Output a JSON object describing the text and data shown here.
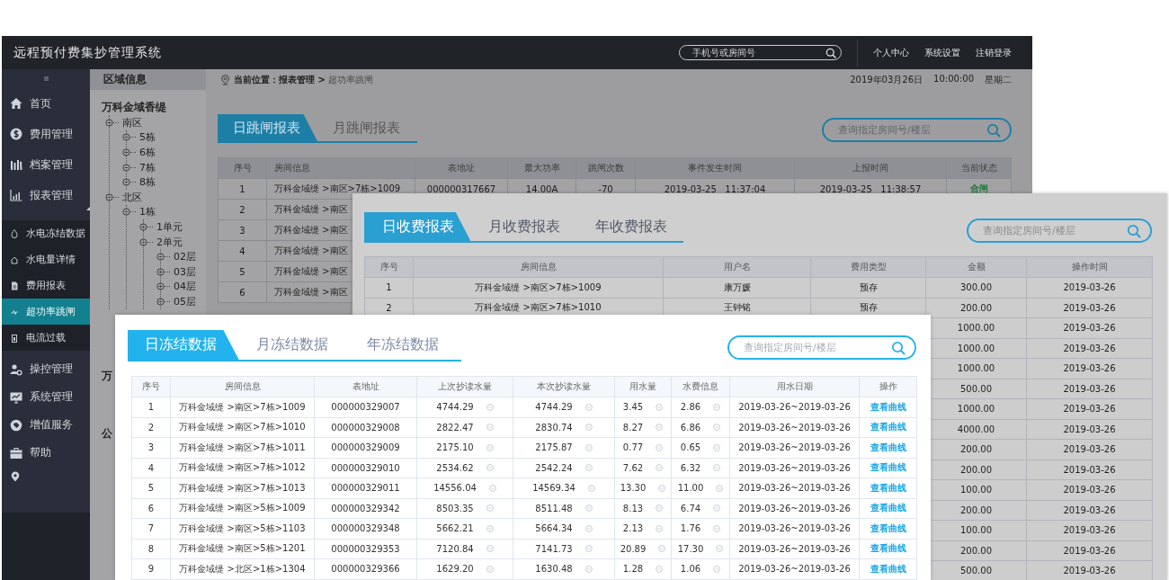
{
  "header": {
    "title": "远程预付费集抄管理系统",
    "search": {
      "placeholder": "手机号或房间号"
    },
    "links": [
      "个人中心",
      "系统设置",
      "注销登录"
    ]
  },
  "sidebar": {
    "items": [
      {
        "label": "首页",
        "selected": false,
        "expanded": false
      },
      {
        "label": "费用管理",
        "selected": false,
        "expanded": false
      },
      {
        "label": "档案管理",
        "selected": false,
        "expanded": false
      },
      {
        "label": "报表管理",
        "selected": false,
        "expanded": true,
        "children": [
          {
            "label": "水电冻结数据",
            "selected": false
          },
          {
            "label": "水电量详情",
            "selected": false
          },
          {
            "label": "费用报表",
            "selected": false
          },
          {
            "label": "超功率跳闸",
            "selected": true
          },
          {
            "label": "电流过载",
            "selected": false
          }
        ]
      },
      {
        "label": "操控管理",
        "selected": false,
        "expanded": false
      },
      {
        "label": "系统管理",
        "selected": false,
        "expanded": false
      },
      {
        "label": "增值服务",
        "selected": false,
        "expanded": false
      },
      {
        "label": "帮助",
        "selected": false,
        "expanded": false
      }
    ]
  },
  "region_panel": {
    "title": "区域信息",
    "nodes": [
      {
        "label": "万科金域香缇",
        "children": [
          {
            "label": "南区",
            "children": [
              {
                "label": "5栋"
              },
              {
                "label": "6栋"
              },
              {
                "label": "7栋"
              },
              {
                "label": "8栋"
              }
            ]
          },
          {
            "label": "北区",
            "children": [
              {
                "label": "1栋",
                "children": [
                  {
                    "label": "1单元"
                  },
                  {
                    "label": "2单元",
                    "children": [
                      {
                        "label": "02层"
                      },
                      {
                        "label": "03层"
                      },
                      {
                        "label": "04层"
                      },
                      {
                        "label": "05层"
                      }
                    ]
                  }
                ]
              }
            ]
          }
        ]
      },
      {
        "label": "万"
      },
      {
        "label": "公"
      }
    ]
  },
  "breadcrumb": "**当前位置：报表管理 >** 超功率跳闸",
  "datetime": {
    "date": "2019年03月26日",
    "time": "10:00:00",
    "weekday": "星期二"
  },
  "trip_report": {
    "tabs": [
      {
        "label": "日跳闸报表",
        "selected": true
      },
      {
        "label": "月跳闸报表",
        "selected": false
      }
    ],
    "search": {
      "placeholder": "查询指定房间号/楼层"
    },
    "table": {
      "columns": [
        {
          "label": "序号",
          "kind": "text"
        },
        {
          "label": "房间信息",
          "kind": "text"
        },
        {
          "label": "表地址",
          "kind": "text"
        },
        {
          "label": "最大功率",
          "kind": "text"
        },
        {
          "label": "跳闸次数",
          "kind": "text"
        },
        {
          "label": "事件发生时间",
          "kind": "text"
        },
        {
          "label": "上报时间",
          "kind": "text"
        },
        {
          "label": "当前状态",
          "kind": "status"
        }
      ],
      "rows": [
        {
          "seq": "1",
          "room": "万科金域缇 >南区>7栋>1009",
          "meter": "000000317667",
          "max_power": "14.00A",
          "trips": "-70",
          "event_time": "2019-03-25   11:37:04",
          "report_time": "2019-03-25   11:38:57",
          "status": "合闸"
        },
        {
          "seq": "2",
          "room": "万科金域缇 >南区"
        },
        {
          "seq": "3",
          "room": "万科金域缇 >南区"
        },
        {
          "seq": "4",
          "room": "万科金域缇 >南区"
        },
        {
          "seq": "5",
          "room": "万科金域缇 >南区"
        },
        {
          "seq": "6",
          "room": "万科金域缇 >南区"
        }
      ]
    }
  },
  "fee_report": {
    "tabs": [
      {
        "label": "日收费报表",
        "selected": true
      },
      {
        "label": "月收费报表",
        "selected": false
      },
      {
        "label": "年收费报表",
        "selected": false
      }
    ],
    "search": {
      "placeholder": "查询指定房间号/楼层"
    },
    "table": {
      "columns": [
        {
          "label": "序号",
          "kind": "text"
        },
        {
          "label": "房间信息",
          "kind": "text"
        },
        {
          "label": "用户名",
          "kind": "text"
        },
        {
          "label": "费用类型",
          "kind": "text"
        },
        {
          "label": "金额",
          "kind": "text"
        },
        {
          "label": "操作时间",
          "kind": "text"
        }
      ],
      "rows": [
        {
          "seq": "1",
          "room": "万科金域缇 >南区>7栋>1009",
          "user": "康万媛",
          "fee_type": "预存",
          "amount": "300.00",
          "time": "2019-03-26"
        },
        {
          "seq": "2",
          "room": "万科金域缇 >南区>7栋>1010",
          "user": "王钟铭",
          "fee_type": "预存",
          "amount": "200.00",
          "time": "2019-03-26"
        },
        {
          "amount": "1000.00",
          "time": "2019-03-26"
        },
        {
          "amount": "1000.00",
          "time": "2019-03-26"
        },
        {
          "amount": "1000.00",
          "time": "2019-03-26"
        },
        {
          "amount": "500.00",
          "time": "2019-03-26"
        },
        {
          "amount": "1000.00",
          "time": "2019-03-26"
        },
        {
          "amount": "4000.00",
          "time": "2019-03-26"
        },
        {
          "amount": "200.00",
          "time": "2019-03-26"
        },
        {
          "amount": "200.00",
          "time": "2019-03-26"
        },
        {
          "amount": "100.00",
          "time": "2019-03-26"
        },
        {
          "amount": "200.00",
          "time": "2019-03-26"
        },
        {
          "amount": "100.00",
          "time": "2019-03-26"
        },
        {
          "amount": "200.00",
          "time": "2019-03-26"
        },
        {
          "amount": "500.00",
          "time": "2019-03-26"
        }
      ]
    }
  },
  "freeze_report": {
    "tabs": [
      {
        "label": "日冻结数据",
        "selected": true
      },
      {
        "label": "月冻结数据",
        "selected": false
      },
      {
        "label": "年冻结数据",
        "selected": false
      }
    ],
    "search": {
      "placeholder": "查询指定房间号/楼层"
    },
    "table": {
      "columns": [
        {
          "label": "序号",
          "kind": "text"
        },
        {
          "label": "房间信息",
          "kind": "text"
        },
        {
          "label": "表地址",
          "kind": "text"
        },
        {
          "label": "上次抄读水量",
          "kind": "reading"
        },
        {
          "label": "本次抄读水量",
          "kind": "reading"
        },
        {
          "label": "用水量",
          "kind": "reading"
        },
        {
          "label": "水费信息",
          "kind": "reading"
        },
        {
          "label": "用水日期",
          "kind": "text"
        },
        {
          "label": "操作",
          "kind": "link"
        }
      ],
      "rows": [
        {
          "seq": "1",
          "room": "万科金域缇 >南区>7栋>1009",
          "meter": "000000329007",
          "last_reading": "4744.29",
          "reading": "4744.29",
          "usage": "3.45",
          "fee": "2.86",
          "period": "2019-03-26~2019-03-26",
          "action": "查看曲线"
        },
        {
          "seq": "2",
          "room": "万科金域缇 >南区>7栋>1010",
          "meter": "000000329008",
          "last_reading": "2822.47",
          "reading": "2830.74",
          "usage": "8.27",
          "fee": "6.86",
          "period": "2019-03-26~2019-03-26",
          "action": "查看曲线"
        },
        {
          "seq": "3",
          "room": "万科金域缇 >南区>7栋>1011",
          "meter": "000000329009",
          "last_reading": "2175.10",
          "reading": "2175.87",
          "usage": "0.77",
          "fee": "0.65",
          "period": "2019-03-26~2019-03-26",
          "action": "查看曲线"
        },
        {
          "seq": "4",
          "room": "万科金域缇 >南区>7栋>1012",
          "meter": "000000329010",
          "last_reading": "2534.62",
          "reading": "2542.24",
          "usage": "7.62",
          "fee": "6.32",
          "period": "2019-03-26~2019-03-26",
          "action": "查看曲线"
        },
        {
          "seq": "5",
          "room": "万科金域缇 >南区>7栋>1013",
          "meter": "000000329011",
          "last_reading": "14556.04",
          "reading": "14569.34",
          "usage": "13.30",
          "fee": "11.00",
          "period": "2019-03-26~2019-03-26",
          "action": "查看曲线"
        },
        {
          "seq": "6",
          "room": "万科金域缇 >南区>5栋>1009",
          "meter": "000000329342",
          "last_reading": "8503.35",
          "reading": "8511.48",
          "usage": "8.13",
          "fee": "6.74",
          "period": "2019-03-26~2019-03-26",
          "action": "查看曲线"
        },
        {
          "seq": "7",
          "room": "万科金域缇 >南区>5栋>1103",
          "meter": "000000329348",
          "last_reading": "5662.21",
          "reading": "5664.34",
          "usage": "2.13",
          "fee": "1.76",
          "period": "2019-03-26~2019-03-26",
          "action": "查看曲线"
        },
        {
          "seq": "8",
          "room": "万科金域缇 >南区>5栋>1201",
          "meter": "000000329353",
          "last_reading": "7120.84",
          "reading": "7141.73",
          "usage": "20.89",
          "fee": "17.30",
          "period": "2019-03-26~2019-03-26",
          "action": "查看曲线"
        },
        {
          "seq": "9",
          "room": "万科金域缇 >北区>1栋>1304",
          "meter": "000000329366",
          "last_reading": "1629.20",
          "reading": "1630.48",
          "usage": "1.28",
          "fee": "1.06",
          "period": "2019-03-26~2019-03-26",
          "action": "查看曲线"
        }
      ]
    }
  }
}
